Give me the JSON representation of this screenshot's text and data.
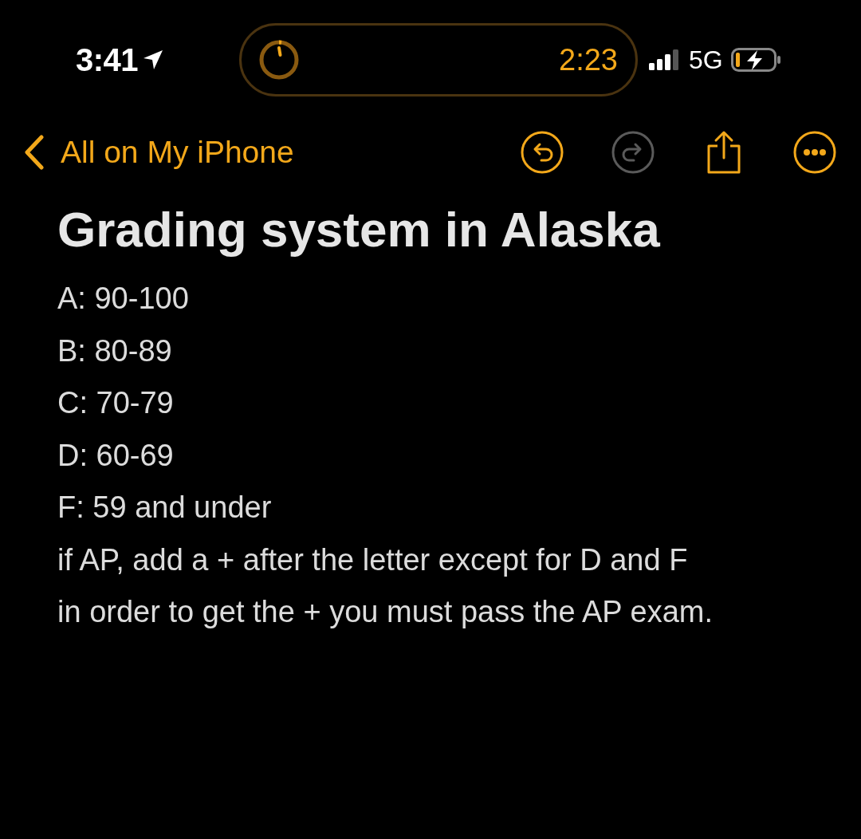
{
  "status_bar": {
    "time": "3:41",
    "live_activity": {
      "timer": "2:23"
    },
    "network": "5G"
  },
  "nav": {
    "back_label": "All on My iPhone",
    "actions": [
      {
        "kind": "undo",
        "disabled": false
      },
      {
        "kind": "redo",
        "disabled": true
      },
      {
        "kind": "share",
        "disabled": false
      },
      {
        "kind": "more",
        "disabled": false
      }
    ]
  },
  "note": {
    "title": "Grading system in Alaska",
    "lines": [
      "A: 90-100",
      "B: 80-89",
      "C: 70-79",
      "D: 60-69",
      "F: 59 and under",
      "if AP, add a + after the letter except for D and F",
      "in order to get the + you must pass the AP exam."
    ]
  }
}
